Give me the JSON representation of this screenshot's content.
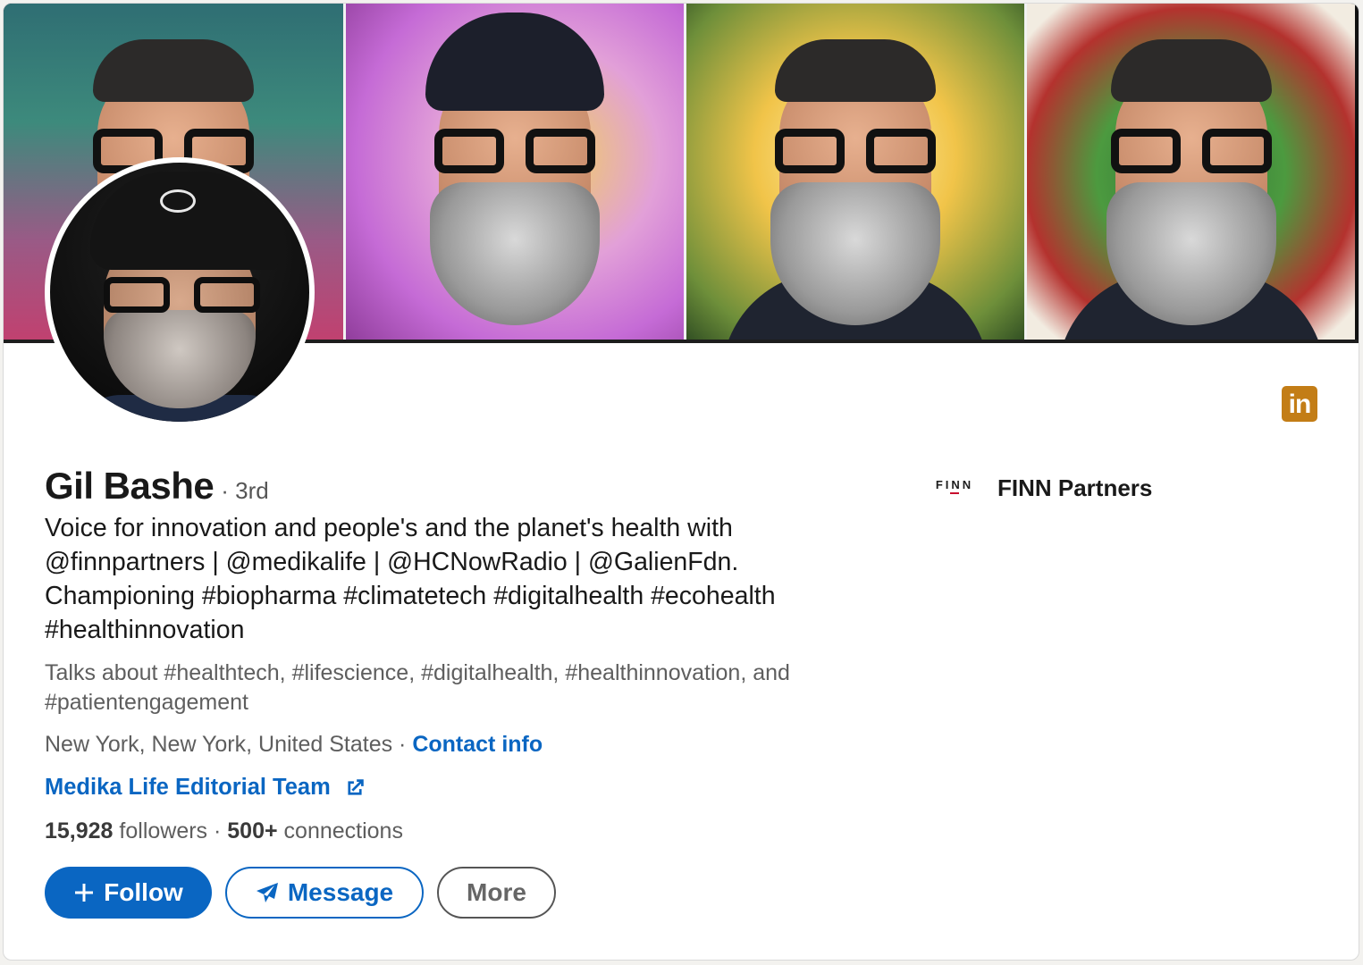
{
  "profile": {
    "name": "Gil Bashe",
    "degree": "· 3rd",
    "headline": "Voice for innovation and people's and the planet's health with @finnpartners | @medikalife | @HCNowRadio | @GalienFdn. Championing #biopharma #climatetech #digitalhealth #ecohealth #healthinnovation",
    "talks_about": "Talks about #healthtech, #lifescience, #digitalhealth, #healthinnovation, and #patientengagement",
    "location": "New York, New York, United States",
    "separator": " · ",
    "contact_info": "Contact info",
    "website": "Medika Life Editorial Team",
    "followers_count": "15,928",
    "followers_label": " followers",
    "stats_separator": " · ",
    "connections_count": "500+",
    "connections_label": " connections"
  },
  "company": {
    "logo_text": "FINN",
    "name": "FINN Partners"
  },
  "actions": {
    "follow": "Follow",
    "message": "Message",
    "more": "More"
  },
  "icons": {
    "linkedin": "in",
    "follow": "plus-icon",
    "message": "paper-plane-icon",
    "website": "external-link-icon"
  },
  "colors": {
    "accent": "#0a66c2",
    "linkedin_badge": "#c37d16",
    "text_primary": "#191919",
    "text_secondary": "#5e5e5e"
  }
}
